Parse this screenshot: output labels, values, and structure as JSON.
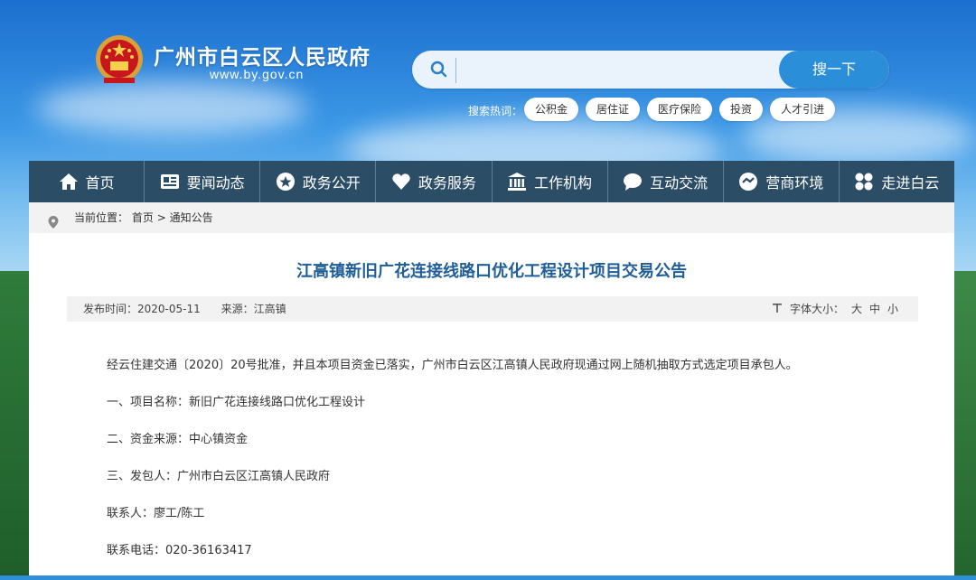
{
  "header": {
    "site_title": "广州市白云区人民政府",
    "site_url": "www.by.gov.cn",
    "search": {
      "placeholder": "",
      "button_label": "搜一下",
      "hot_label": "搜索热词：",
      "hot_words": [
        "公积金",
        "居住证",
        "医疗保险",
        "投资",
        "人才引进"
      ]
    }
  },
  "nav": {
    "items": [
      {
        "label": "首页",
        "icon": "home-icon"
      },
      {
        "label": "要闻动态",
        "icon": "news-icon"
      },
      {
        "label": "政务公开",
        "icon": "star-icon"
      },
      {
        "label": "政务服务",
        "icon": "heart-icon"
      },
      {
        "label": "工作机构",
        "icon": "building-icon"
      },
      {
        "label": "互动交流",
        "icon": "chat-icon"
      },
      {
        "label": "营商环境",
        "icon": "handshake-icon"
      },
      {
        "label": "走进白云",
        "icon": "grid-icon"
      }
    ]
  },
  "breadcrumb": {
    "prefix": "当前位置：",
    "home": "首页",
    "sep": ">",
    "current": "通知公告"
  },
  "article": {
    "title": "江高镇新旧广花连接线路口优化工程设计项目交易公告",
    "meta": {
      "publish_time": "发布时间：2020-05-11",
      "source": "来源：江高镇",
      "font_size_label": "字体大小：",
      "font_large": "大",
      "font_medium": "中",
      "font_small": "小"
    },
    "paragraphs": [
      "经云住建交通〔2020〕20号批准，并且本项目资金已落实，广州市白云区江高镇人民政府现通过网上随机抽取方式选定项目承包人。",
      "一、项目名称：新旧广花连接线路口优化工程设计",
      "二、资金来源：中心镇资金",
      "三、发包人：广州市白云区江高镇人民政府",
      "联系人：廖工/陈工",
      "联系电话：020-36163417"
    ]
  },
  "colors": {
    "nav_bg": "#2c4d66",
    "title_blue": "#1f5e99",
    "search_button": "#2a8fd8"
  }
}
